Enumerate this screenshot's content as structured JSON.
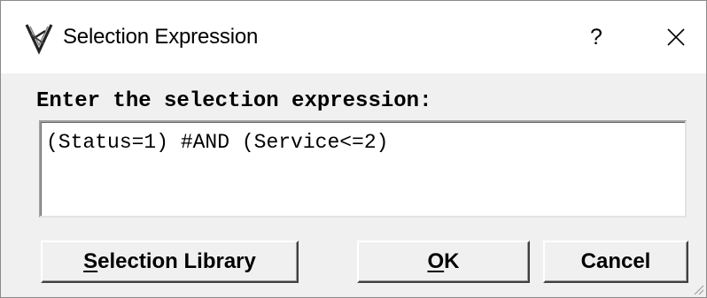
{
  "window": {
    "title": "Selection Expression",
    "help_label": "?",
    "icon": "app-logo-icon"
  },
  "prompt": {
    "label": "Enter the selection expression:"
  },
  "expression": {
    "value": "(Status=1) #AND (Service<=2)"
  },
  "buttons": {
    "library": {
      "mnemonic": "S",
      "rest": "election Library"
    },
    "ok": {
      "mnemonic": "O",
      "rest": "K"
    },
    "cancel": {
      "label": "Cancel"
    }
  }
}
